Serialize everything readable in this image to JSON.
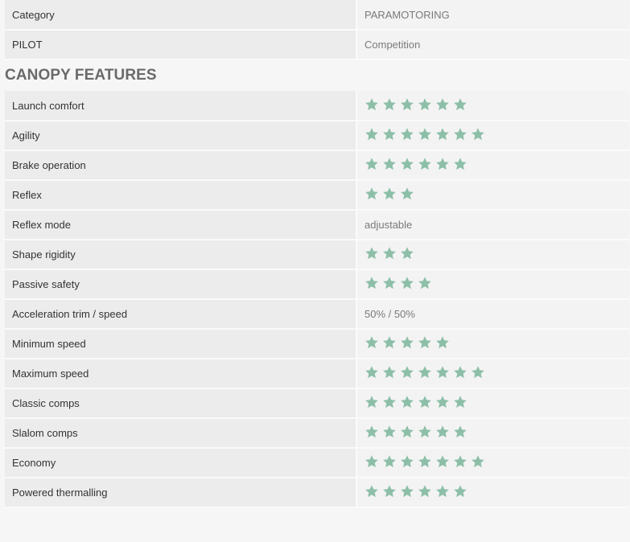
{
  "header_rows": [
    {
      "label": "Category",
      "value": "PARAMOTORING"
    },
    {
      "label": "PILOT",
      "value": "Competition"
    }
  ],
  "section": {
    "title": "CANOPY FEATURES"
  },
  "colors": {
    "star": "#8dbfa8"
  },
  "features": [
    {
      "label": "Launch comfort",
      "rating": 6,
      "text": ""
    },
    {
      "label": "Agility",
      "rating": 7,
      "text": ""
    },
    {
      "label": "Brake operation",
      "rating": 6,
      "text": ""
    },
    {
      "label": "Reflex",
      "rating": 3,
      "text": ""
    },
    {
      "label": "Reflex mode",
      "rating": 0,
      "text": "adjustable"
    },
    {
      "label": "Shape rigidity",
      "rating": 3,
      "text": ""
    },
    {
      "label": "Passive safety",
      "rating": 4,
      "text": ""
    },
    {
      "label": "Acceleration trim / speed",
      "rating": 0,
      "text": "50% / 50%"
    },
    {
      "label": "Minimum speed",
      "rating": 5,
      "text": ""
    },
    {
      "label": "Maximum speed",
      "rating": 7,
      "text": ""
    },
    {
      "label": "Classic comps",
      "rating": 6,
      "text": ""
    },
    {
      "label": "Slalom comps",
      "rating": 6,
      "text": ""
    },
    {
      "label": "Economy",
      "rating": 7,
      "text": ""
    },
    {
      "label": "Powered thermalling",
      "rating": 6,
      "text": ""
    }
  ]
}
